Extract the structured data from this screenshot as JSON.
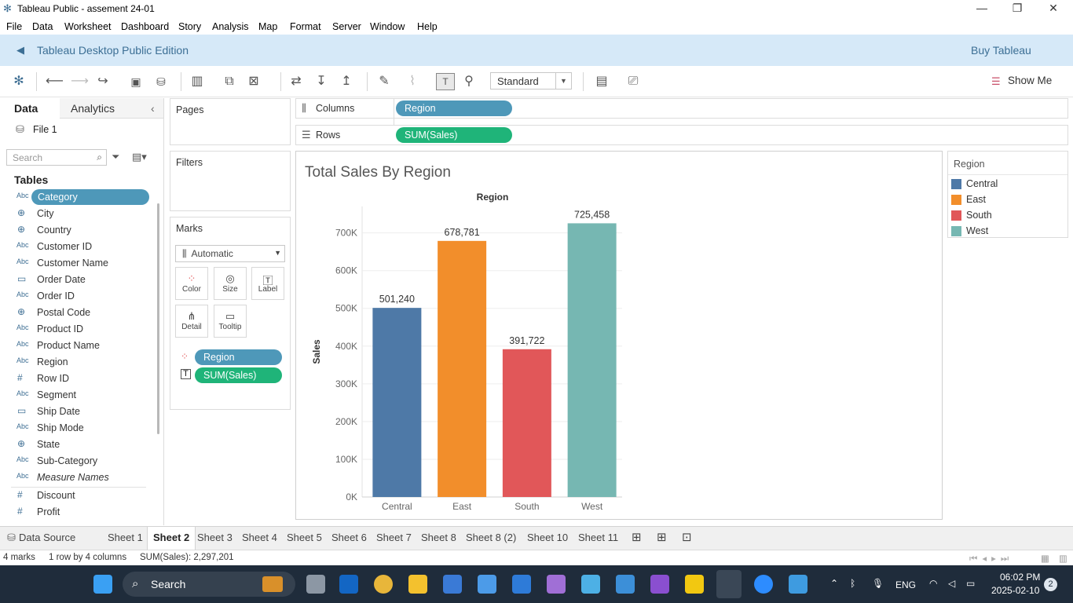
{
  "window": {
    "title": "Tableau Public - assement 24-01",
    "minimize": "—",
    "restore": "❐",
    "close": "✕"
  },
  "menu": [
    "File",
    "Data",
    "Worksheet",
    "Dashboard",
    "Story",
    "Analysis",
    "Map",
    "Format",
    "Server",
    "Window",
    "Help"
  ],
  "banner": {
    "edition": "Tableau Desktop Public Edition",
    "buy": "Buy Tableau"
  },
  "toolbar": {
    "mark_type": "Standard",
    "show_me": "Show Me"
  },
  "left_pane": {
    "tab_data": "Data",
    "tab_analytics": "Analytics",
    "datasource": "File 1",
    "search_placeholder": "Search",
    "tables_label": "Tables",
    "fields": [
      {
        "icon": "Abc",
        "name": "Category"
      },
      {
        "icon": "⊕",
        "name": "City"
      },
      {
        "icon": "⊕",
        "name": "Country"
      },
      {
        "icon": "Abc",
        "name": "Customer ID"
      },
      {
        "icon": "Abc",
        "name": "Customer Name"
      },
      {
        "icon": "▭",
        "name": "Order Date"
      },
      {
        "icon": "Abc",
        "name": "Order ID"
      },
      {
        "icon": "⊕",
        "name": "Postal Code"
      },
      {
        "icon": "Abc",
        "name": "Product ID"
      },
      {
        "icon": "Abc",
        "name": "Product Name"
      },
      {
        "icon": "Abc",
        "name": "Region"
      },
      {
        "icon": "#",
        "name": "Row ID"
      },
      {
        "icon": "Abc",
        "name": "Segment"
      },
      {
        "icon": "▭",
        "name": "Ship Date"
      },
      {
        "icon": "Abc",
        "name": "Ship Mode"
      },
      {
        "icon": "⊕",
        "name": "State"
      },
      {
        "icon": "Abc",
        "name": "Sub-Category"
      },
      {
        "icon": "Abc",
        "name": "Measure Names"
      },
      {
        "icon": "#",
        "name": "Discount"
      },
      {
        "icon": "#",
        "name": "Profit"
      }
    ]
  },
  "cards": {
    "pages": "Pages",
    "filters": "Filters",
    "marks": "Marks",
    "mark_select": "Automatic",
    "mark_buttons": [
      "Color",
      "Size",
      "Label",
      "Detail",
      "Tooltip"
    ],
    "mark_pills": [
      "Region",
      "SUM(Sales)"
    ]
  },
  "shelves": {
    "columns_label": "Columns",
    "columns_pill": "Region",
    "rows_label": "Rows",
    "rows_pill": "SUM(Sales)"
  },
  "legend": {
    "title": "Region",
    "items": [
      {
        "label": "Central",
        "color": "#4e79a7"
      },
      {
        "label": "East",
        "color": "#f28e2b"
      },
      {
        "label": "South",
        "color": "#e15759"
      },
      {
        "label": "West",
        "color": "#76b7b2"
      }
    ]
  },
  "chart_data": {
    "type": "bar",
    "title": "Total Sales By Region",
    "column_header": "Region",
    "ylabel": "Sales",
    "categories": [
      "Central",
      "East",
      "South",
      "West"
    ],
    "values": [
      501240,
      678781,
      391722,
      725458
    ],
    "value_labels": [
      "501,240",
      "678,781",
      "391,722",
      "725,458"
    ],
    "colors": [
      "#4e79a7",
      "#f28e2b",
      "#e15759",
      "#76b7b2"
    ],
    "ylim": [
      0,
      770000
    ],
    "yticks": [
      0,
      100000,
      200000,
      300000,
      400000,
      500000,
      600000,
      700000
    ],
    "ytick_labels": [
      "0K",
      "100K",
      "200K",
      "300K",
      "400K",
      "500K",
      "600K",
      "700K"
    ],
    "grid": true
  },
  "sheets": {
    "data_source": "Data Source",
    "tabs": [
      "Sheet 1",
      "Sheet 2",
      "Sheet 3",
      "Sheet 4",
      "Sheet 5",
      "Sheet 6",
      "Sheet 7",
      "Sheet 8",
      "Sheet 8 (2)",
      "Sheet 10",
      "Sheet 11"
    ],
    "active": "Sheet 2"
  },
  "status": {
    "marks": "4 marks",
    "dims": "1 row by 4 columns",
    "sum": "SUM(Sales): 2,297,201"
  },
  "taskbar": {
    "search": "Search",
    "lang": "ENG",
    "time": "06:02 PM",
    "date": "2025-02-10",
    "notif": "2"
  }
}
